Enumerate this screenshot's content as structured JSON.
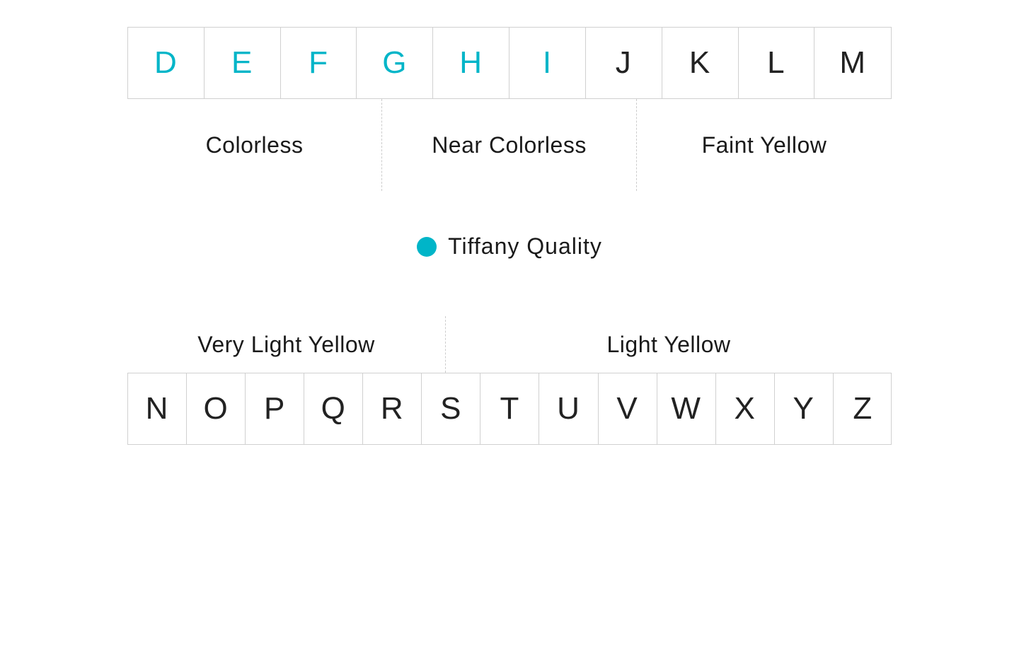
{
  "colors": {
    "tiffany": "#00b5c8",
    "text_dark": "#1a1a1a",
    "border": "#d0d0d0",
    "dashed_border": "#cccccc"
  },
  "top_grades": [
    {
      "letter": "D",
      "tiffany": true
    },
    {
      "letter": "E",
      "tiffany": true
    },
    {
      "letter": "F",
      "tiffany": true
    },
    {
      "letter": "G",
      "tiffany": true
    },
    {
      "letter": "H",
      "tiffany": true
    },
    {
      "letter": "I",
      "tiffany": true
    },
    {
      "letter": "J",
      "tiffany": false
    },
    {
      "letter": "K",
      "tiffany": false
    },
    {
      "letter": "L",
      "tiffany": false
    },
    {
      "letter": "M",
      "tiffany": false
    }
  ],
  "categories_top": [
    {
      "label": "Colorless"
    },
    {
      "label": "Near Colorless"
    },
    {
      "label": "Faint Yellow"
    }
  ],
  "legend": {
    "label": "Tiffany Quality"
  },
  "categories_bottom": [
    {
      "label": "Very Light Yellow"
    },
    {
      "label": "Light Yellow"
    }
  ],
  "bottom_grades": [
    {
      "letter": "N"
    },
    {
      "letter": "O"
    },
    {
      "letter": "P"
    },
    {
      "letter": "Q"
    },
    {
      "letter": "R"
    },
    {
      "letter": "S"
    },
    {
      "letter": "T"
    },
    {
      "letter": "U"
    },
    {
      "letter": "V"
    },
    {
      "letter": "W"
    },
    {
      "letter": "X"
    },
    {
      "letter": "Y"
    },
    {
      "letter": "Z"
    }
  ]
}
